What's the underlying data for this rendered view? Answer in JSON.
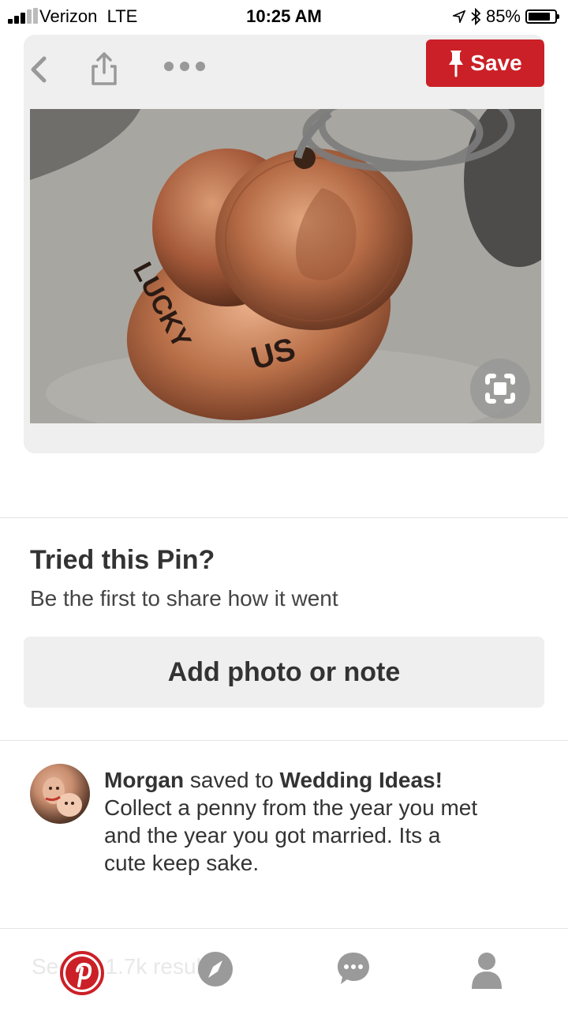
{
  "status_bar": {
    "carrier": "Verizon",
    "network": "LTE",
    "time": "10:25 AM",
    "battery": "85%",
    "battery_level": 0.85
  },
  "pin": {
    "save_label": "Save"
  },
  "tried": {
    "title": "Tried this Pin?",
    "subtitle": "Be the first to share how it went",
    "button_label": "Add photo or note"
  },
  "saved": {
    "user": "Morgan",
    "connector": " saved to ",
    "board": "Wedding Ideas!",
    "description": "Collect a penny from the year you met and the year you got married. Its a cute keep sake."
  },
  "tab_bar": {
    "ghost_text": "See all 1.7k results",
    "tabs": [
      "home",
      "explore",
      "messages",
      "profile"
    ]
  },
  "colors": {
    "accent": "#cb2027",
    "icon_gray": "#9a9a9a"
  }
}
